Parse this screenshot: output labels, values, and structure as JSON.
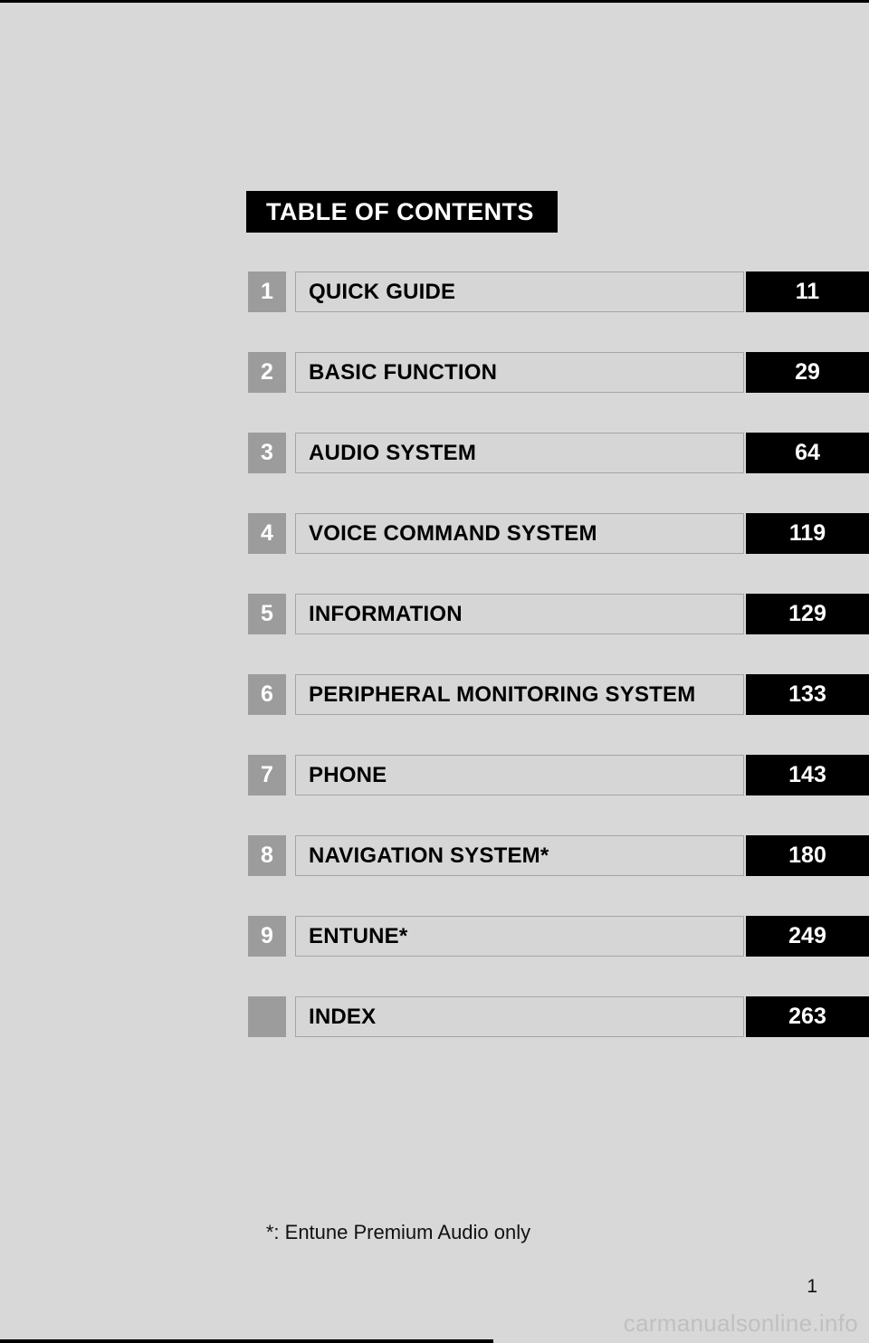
{
  "page": {
    "background_color": "#d8d8d8",
    "accent_color": "#000000",
    "number_box_color": "#9c9c9c",
    "title_box_color": "#d6d6d6"
  },
  "banner": {
    "title": "TABLE OF CONTENTS"
  },
  "toc": {
    "rows": [
      {
        "number": "1",
        "title": "QUICK GUIDE",
        "page": "11"
      },
      {
        "number": "2",
        "title": "BASIC FUNCTION",
        "page": "29"
      },
      {
        "number": "3",
        "title": "AUDIO SYSTEM",
        "page": "64"
      },
      {
        "number": "4",
        "title": "VOICE COMMAND SYSTEM",
        "page": "119"
      },
      {
        "number": "5",
        "title": "INFORMATION",
        "page": "129"
      },
      {
        "number": "6",
        "title": "PERIPHERAL MONITORING SYSTEM",
        "page": "133"
      },
      {
        "number": "7",
        "title": "PHONE",
        "page": "143"
      },
      {
        "number": "8",
        "title": "NAVIGATION SYSTEM*",
        "page": "180"
      },
      {
        "number": "9",
        "title": "ENTUNE*",
        "page": "249"
      },
      {
        "number": "",
        "title": "INDEX",
        "page": "263"
      }
    ]
  },
  "footnote": {
    "text": "*: Entune Premium Audio only"
  },
  "footer": {
    "page_number": "1",
    "watermark": "carmanualsonline.info"
  }
}
